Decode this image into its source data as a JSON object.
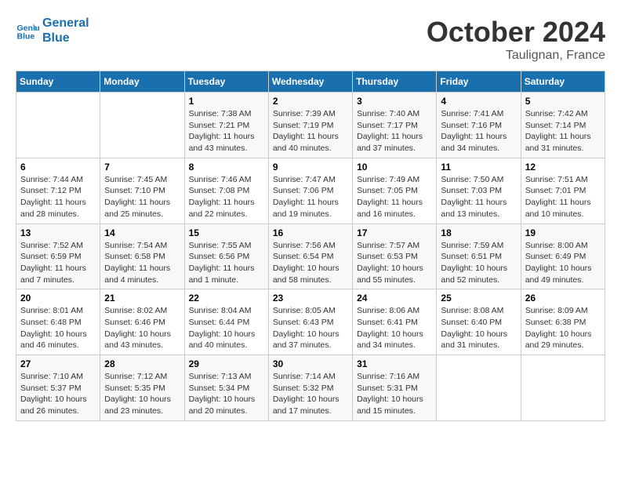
{
  "header": {
    "logo_line1": "General",
    "logo_line2": "Blue",
    "month": "October 2024",
    "location": "Taulignan, France"
  },
  "weekdays": [
    "Sunday",
    "Monday",
    "Tuesday",
    "Wednesday",
    "Thursday",
    "Friday",
    "Saturday"
  ],
  "weeks": [
    [
      {
        "day": "",
        "info": ""
      },
      {
        "day": "",
        "info": ""
      },
      {
        "day": "1",
        "info": "Sunrise: 7:38 AM\nSunset: 7:21 PM\nDaylight: 11 hours and 43 minutes."
      },
      {
        "day": "2",
        "info": "Sunrise: 7:39 AM\nSunset: 7:19 PM\nDaylight: 11 hours and 40 minutes."
      },
      {
        "day": "3",
        "info": "Sunrise: 7:40 AM\nSunset: 7:17 PM\nDaylight: 11 hours and 37 minutes."
      },
      {
        "day": "4",
        "info": "Sunrise: 7:41 AM\nSunset: 7:16 PM\nDaylight: 11 hours and 34 minutes."
      },
      {
        "day": "5",
        "info": "Sunrise: 7:42 AM\nSunset: 7:14 PM\nDaylight: 11 hours and 31 minutes."
      }
    ],
    [
      {
        "day": "6",
        "info": "Sunrise: 7:44 AM\nSunset: 7:12 PM\nDaylight: 11 hours and 28 minutes."
      },
      {
        "day": "7",
        "info": "Sunrise: 7:45 AM\nSunset: 7:10 PM\nDaylight: 11 hours and 25 minutes."
      },
      {
        "day": "8",
        "info": "Sunrise: 7:46 AM\nSunset: 7:08 PM\nDaylight: 11 hours and 22 minutes."
      },
      {
        "day": "9",
        "info": "Sunrise: 7:47 AM\nSunset: 7:06 PM\nDaylight: 11 hours and 19 minutes."
      },
      {
        "day": "10",
        "info": "Sunrise: 7:49 AM\nSunset: 7:05 PM\nDaylight: 11 hours and 16 minutes."
      },
      {
        "day": "11",
        "info": "Sunrise: 7:50 AM\nSunset: 7:03 PM\nDaylight: 11 hours and 13 minutes."
      },
      {
        "day": "12",
        "info": "Sunrise: 7:51 AM\nSunset: 7:01 PM\nDaylight: 11 hours and 10 minutes."
      }
    ],
    [
      {
        "day": "13",
        "info": "Sunrise: 7:52 AM\nSunset: 6:59 PM\nDaylight: 11 hours and 7 minutes."
      },
      {
        "day": "14",
        "info": "Sunrise: 7:54 AM\nSunset: 6:58 PM\nDaylight: 11 hours and 4 minutes."
      },
      {
        "day": "15",
        "info": "Sunrise: 7:55 AM\nSunset: 6:56 PM\nDaylight: 11 hours and 1 minute."
      },
      {
        "day": "16",
        "info": "Sunrise: 7:56 AM\nSunset: 6:54 PM\nDaylight: 10 hours and 58 minutes."
      },
      {
        "day": "17",
        "info": "Sunrise: 7:57 AM\nSunset: 6:53 PM\nDaylight: 10 hours and 55 minutes."
      },
      {
        "day": "18",
        "info": "Sunrise: 7:59 AM\nSunset: 6:51 PM\nDaylight: 10 hours and 52 minutes."
      },
      {
        "day": "19",
        "info": "Sunrise: 8:00 AM\nSunset: 6:49 PM\nDaylight: 10 hours and 49 minutes."
      }
    ],
    [
      {
        "day": "20",
        "info": "Sunrise: 8:01 AM\nSunset: 6:48 PM\nDaylight: 10 hours and 46 minutes."
      },
      {
        "day": "21",
        "info": "Sunrise: 8:02 AM\nSunset: 6:46 PM\nDaylight: 10 hours and 43 minutes."
      },
      {
        "day": "22",
        "info": "Sunrise: 8:04 AM\nSunset: 6:44 PM\nDaylight: 10 hours and 40 minutes."
      },
      {
        "day": "23",
        "info": "Sunrise: 8:05 AM\nSunset: 6:43 PM\nDaylight: 10 hours and 37 minutes."
      },
      {
        "day": "24",
        "info": "Sunrise: 8:06 AM\nSunset: 6:41 PM\nDaylight: 10 hours and 34 minutes."
      },
      {
        "day": "25",
        "info": "Sunrise: 8:08 AM\nSunset: 6:40 PM\nDaylight: 10 hours and 31 minutes."
      },
      {
        "day": "26",
        "info": "Sunrise: 8:09 AM\nSunset: 6:38 PM\nDaylight: 10 hours and 29 minutes."
      }
    ],
    [
      {
        "day": "27",
        "info": "Sunrise: 7:10 AM\nSunset: 5:37 PM\nDaylight: 10 hours and 26 minutes."
      },
      {
        "day": "28",
        "info": "Sunrise: 7:12 AM\nSunset: 5:35 PM\nDaylight: 10 hours and 23 minutes."
      },
      {
        "day": "29",
        "info": "Sunrise: 7:13 AM\nSunset: 5:34 PM\nDaylight: 10 hours and 20 minutes."
      },
      {
        "day": "30",
        "info": "Sunrise: 7:14 AM\nSunset: 5:32 PM\nDaylight: 10 hours and 17 minutes."
      },
      {
        "day": "31",
        "info": "Sunrise: 7:16 AM\nSunset: 5:31 PM\nDaylight: 10 hours and 15 minutes."
      },
      {
        "day": "",
        "info": ""
      },
      {
        "day": "",
        "info": ""
      }
    ]
  ]
}
